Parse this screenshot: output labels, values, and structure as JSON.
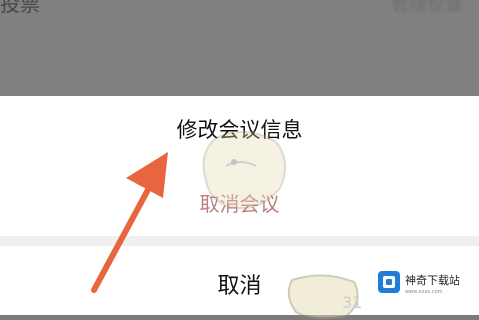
{
  "background": {
    "left_label": "投票",
    "right_label": "管理设置"
  },
  "action_sheet": {
    "edit_label": "修改会议信息",
    "cancel_meeting_label": "取消会议",
    "cancel_label": "取消"
  },
  "watermark": {
    "logo_text": "神奇下载站",
    "logo_sub": "www.xxxx.com",
    "ghost_number": "31"
  },
  "colors": {
    "arrow": "#e8663f",
    "overlay": "#7a7a7a",
    "cancel_meeting_text": "#b06b6b"
  },
  "icons": {
    "pointer": "arrow-pointer-icon",
    "logo": "download-logo-icon"
  }
}
